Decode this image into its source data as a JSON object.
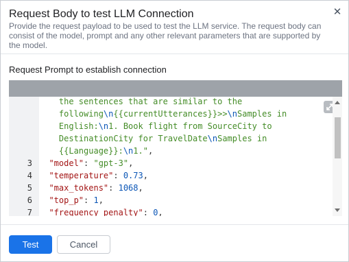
{
  "dialog": {
    "title": "Request Body to test LLM Connection",
    "subtitle": "Provide the request payload to be used to test the LLM service. The request body can consist of the model, prompt and any other relevant parameters that are supported by the model.",
    "close_icon": "close-icon"
  },
  "section": {
    "label": "Request Prompt to establish connection"
  },
  "editor": {
    "expand_icon": "expand-icon",
    "lines": [
      {
        "num": "",
        "tokens": [
          {
            "t": "    the sentences that are similar to the",
            "c": "s"
          }
        ]
      },
      {
        "num": "",
        "tokens": [
          {
            "t": "    following",
            "c": "s"
          },
          {
            "t": "\\n",
            "c": "n"
          },
          {
            "t": "{{currentUtterances}}>>",
            "c": "s"
          },
          {
            "t": "\\n",
            "c": "n"
          },
          {
            "t": "Samples in",
            "c": "s"
          }
        ]
      },
      {
        "num": "",
        "tokens": [
          {
            "t": "    English:",
            "c": "s"
          },
          {
            "t": "\\n",
            "c": "n"
          },
          {
            "t": "1. Book flight from SourceCity to",
            "c": "s"
          }
        ]
      },
      {
        "num": "",
        "tokens": [
          {
            "t": "    DestinationCity for TravelDate",
            "c": "s"
          },
          {
            "t": "\\n",
            "c": "n"
          },
          {
            "t": "Samples in",
            "c": "s"
          }
        ]
      },
      {
        "num": "",
        "tokens": [
          {
            "t": "    {{Language}}:",
            "c": "s"
          },
          {
            "t": "\\n",
            "c": "n"
          },
          {
            "t": "1.\"",
            "c": "s"
          },
          {
            "t": ",",
            "c": "p"
          }
        ]
      },
      {
        "num": "3",
        "tokens": [
          {
            "t": "  ",
            "c": "p"
          },
          {
            "t": "\"model\"",
            "c": "k"
          },
          {
            "t": ": ",
            "c": "p"
          },
          {
            "t": "\"gpt-3\"",
            "c": "s"
          },
          {
            "t": ",",
            "c": "p"
          }
        ]
      },
      {
        "num": "4",
        "tokens": [
          {
            "t": "  ",
            "c": "p"
          },
          {
            "t": "\"temperature\"",
            "c": "k"
          },
          {
            "t": ": ",
            "c": "p"
          },
          {
            "t": "0.73",
            "c": "n"
          },
          {
            "t": ",",
            "c": "p"
          }
        ]
      },
      {
        "num": "5",
        "tokens": [
          {
            "t": "  ",
            "c": "p"
          },
          {
            "t": "\"max_tokens\"",
            "c": "k"
          },
          {
            "t": ": ",
            "c": "p"
          },
          {
            "t": "1068",
            "c": "n"
          },
          {
            "t": ",",
            "c": "p"
          }
        ]
      },
      {
        "num": "6",
        "tokens": [
          {
            "t": "  ",
            "c": "p"
          },
          {
            "t": "\"top_p\"",
            "c": "k"
          },
          {
            "t": ": ",
            "c": "p"
          },
          {
            "t": "1",
            "c": "n"
          },
          {
            "t": ",",
            "c": "p"
          }
        ]
      },
      {
        "num": "7",
        "tokens": [
          {
            "t": "  ",
            "c": "p"
          },
          {
            "t": "\"frequency_penalty\"",
            "c": "k"
          },
          {
            "t": ": ",
            "c": "p"
          },
          {
            "t": "0",
            "c": "n"
          },
          {
            "t": ",",
            "c": "p"
          }
        ]
      }
    ]
  },
  "footer": {
    "test_label": "Test",
    "cancel_label": "Cancel"
  },
  "colors": {
    "primary": "#1a73e8",
    "editor_bar": "#9ea3a9",
    "gutter": "#f1f2f4",
    "string": "#448c27",
    "key": "#a31515",
    "number": "#0b56b6"
  }
}
